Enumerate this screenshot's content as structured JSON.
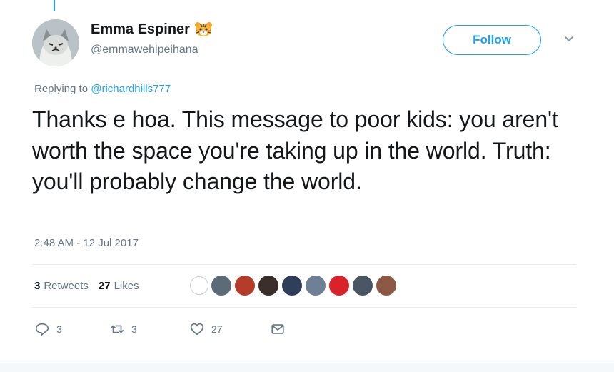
{
  "author": {
    "display_name": "Emma Espiner",
    "name_emoji": "tiger-face-emoji",
    "handle": "@emmawehipeihana",
    "avatar": "grumpy-cat-avatar"
  },
  "follow_button": {
    "label": "Follow"
  },
  "reply": {
    "prefix": "Replying to ",
    "mention": "@richardhills777"
  },
  "tweet": {
    "text": "Thanks e hoa. This message to poor kids: you aren't worth the space you're taking up in the world. Truth: you'll probably change the world.",
    "timestamp": "2:48 AM - 12 Jul 2017"
  },
  "stats": {
    "retweets_count": "3",
    "retweets_label": "Retweets",
    "likes_count": "27",
    "likes_label": "Likes"
  },
  "likers": [
    {
      "name": "liker-avatar-1",
      "color": "#9aa3a8"
    },
    {
      "name": "liker-avatar-2",
      "color": "#5b6b78"
    },
    {
      "name": "liker-avatar-3",
      "color": "#b43c2a"
    },
    {
      "name": "liker-avatar-4",
      "color": "#3a2f2a"
    },
    {
      "name": "liker-avatar-5",
      "color": "#2f3f5a"
    },
    {
      "name": "liker-avatar-6",
      "color": "#6f8094"
    },
    {
      "name": "liker-avatar-7",
      "color": "#d8232a"
    },
    {
      "name": "liker-avatar-8",
      "color": "#4a5663"
    },
    {
      "name": "liker-avatar-9",
      "color": "#8c5a44"
    }
  ],
  "actions": {
    "reply_count": "3",
    "retweet_count": "3",
    "like_count": "27"
  },
  "colors": {
    "accent": "#1da1f2",
    "text_primary": "#14171a",
    "text_secondary": "#657786",
    "divider": "#e6ecf0"
  }
}
